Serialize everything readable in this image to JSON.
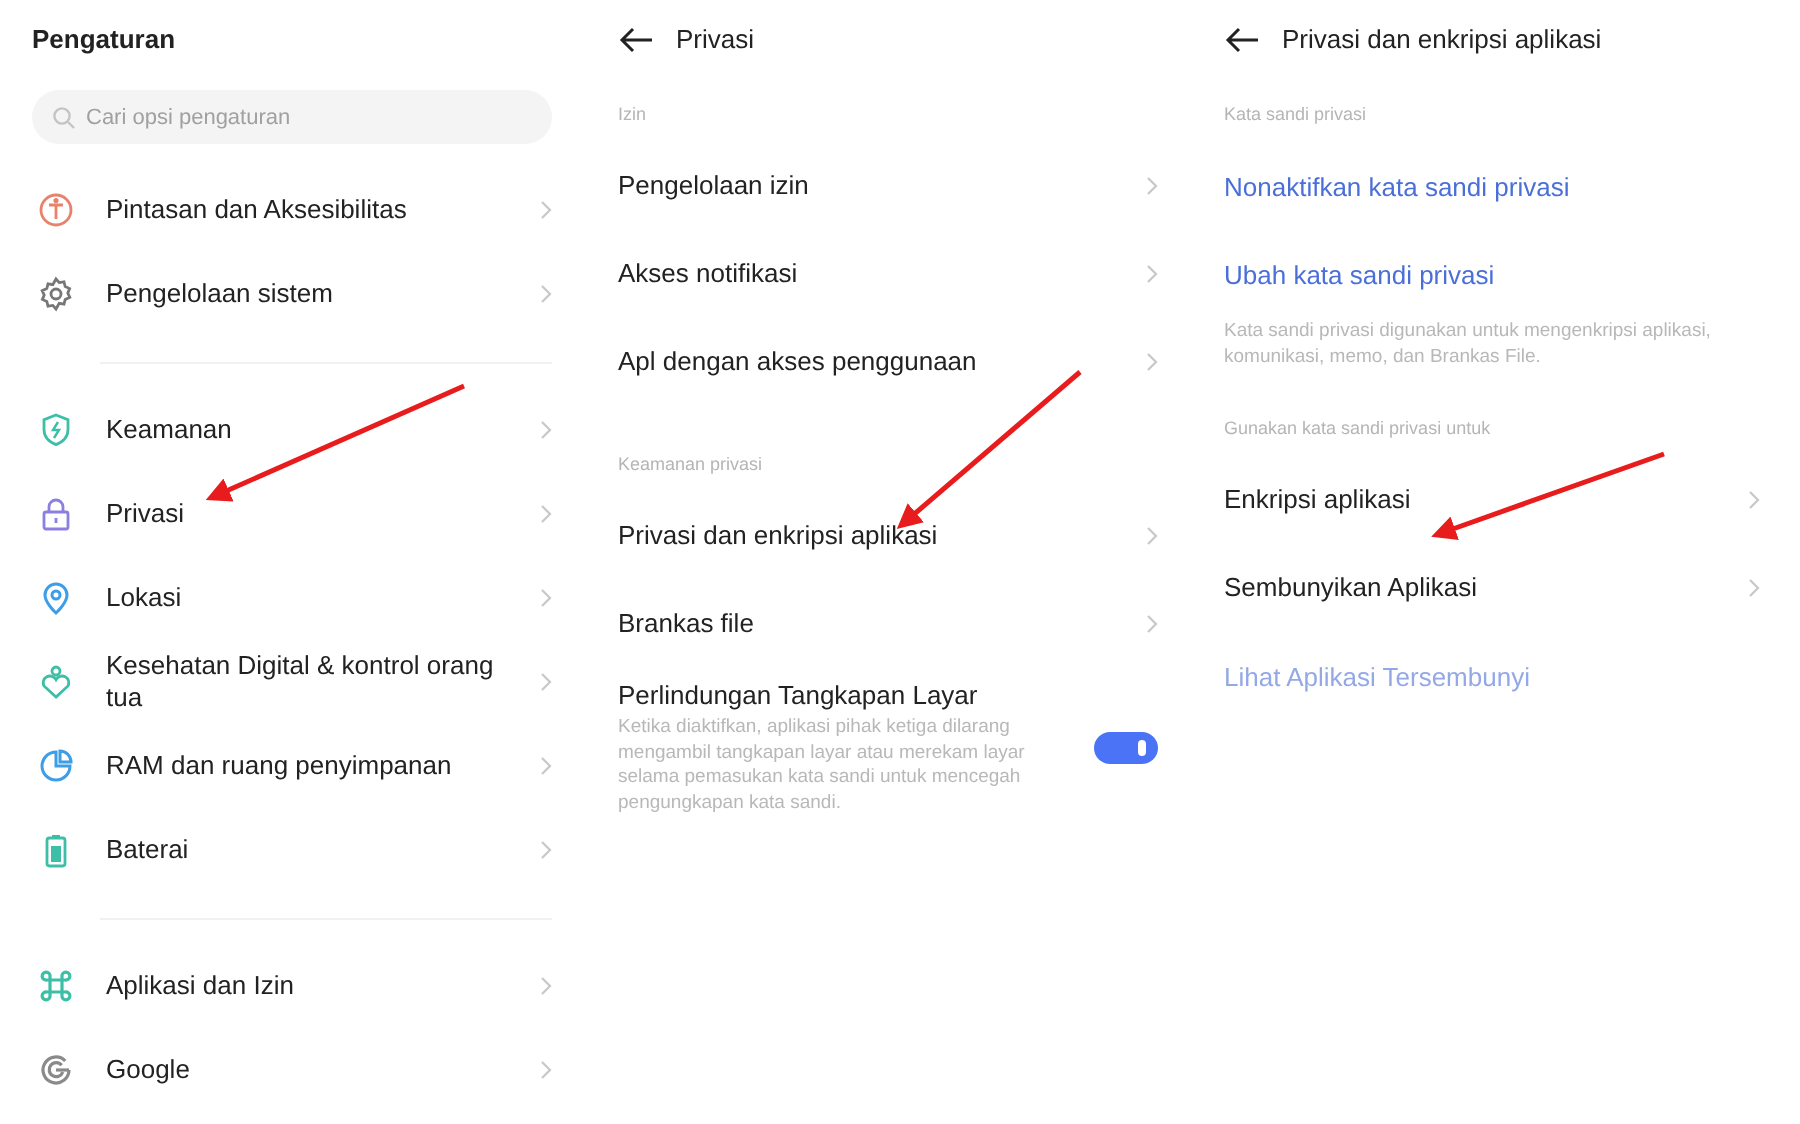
{
  "screens": [
    {
      "kind": "settings",
      "title": "Pengaturan",
      "search": {
        "placeholder": "Cari opsi pengaturan"
      },
      "groups": [
        {
          "items": [
            {
              "label": "Pintasan dan Aksesibilitas",
              "kind": "accessibility",
              "color": "#e8826c"
            },
            {
              "label": "Pengelolaan sistem",
              "kind": "gear",
              "color": "#777777"
            }
          ]
        },
        {
          "items": [
            {
              "label": "Keamanan",
              "kind": "shield",
              "color": "#3cbfa6"
            },
            {
              "label": "Privasi",
              "kind": "lock",
              "color": "#8b7fe0"
            },
            {
              "label": "Lokasi",
              "kind": "pin",
              "color": "#3d9de6"
            },
            {
              "label": "Kesehatan Digital & kontrol orang tua",
              "kind": "wellbeing",
              "color": "#3cbfa6"
            },
            {
              "label": "RAM dan ruang penyimpanan",
              "kind": "pie",
              "color": "#3d9de6"
            },
            {
              "label": "Baterai",
              "kind": "battery",
              "color": "#3cbfa6"
            }
          ]
        },
        {
          "items": [
            {
              "label": "Aplikasi dan Izin",
              "kind": "apps",
              "color": "#3cbfa6"
            },
            {
              "label": "Google",
              "kind": "google",
              "color": "#8a8a8a"
            }
          ]
        }
      ]
    },
    {
      "kind": "detail",
      "title": "Privasi",
      "sections": [
        {
          "label": "Izin",
          "items": [
            {
              "kind": "link",
              "label": "Pengelolaan izin"
            },
            {
              "kind": "link",
              "label": "Akses notifikasi"
            },
            {
              "kind": "link",
              "label": "Apl dengan akses penggunaan"
            }
          ]
        },
        {
          "label": "Keamanan privasi",
          "items": [
            {
              "kind": "link",
              "label": "Privasi dan enkripsi aplikasi"
            },
            {
              "kind": "link",
              "label": "Brankas file"
            },
            {
              "kind": "switch",
              "label": "Perlindungan Tangkapan Layar",
              "description": "Ketika diaktifkan, aplikasi pihak ketiga dilarang mengambil tangkapan layar atau merekam layar selama pemasukan kata sandi untuk mencegah pengungkapan kata sandi.",
              "on": true
            }
          ]
        }
      ]
    },
    {
      "kind": "detail",
      "title": "Privasi dan enkripsi aplikasi",
      "sections": [
        {
          "label": "Kata sandi privasi",
          "items": [
            {
              "kind": "action",
              "label": "Nonaktifkan kata sandi privasi",
              "disabled": false
            },
            {
              "kind": "action",
              "label": "Ubah kata sandi privasi",
              "disabled": false
            }
          ],
          "note": "Kata sandi privasi digunakan untuk mengenkripsi aplikasi, komunikasi, memo, dan Brankas File."
        },
        {
          "label": "Gunakan kata sandi privasi untuk",
          "items": [
            {
              "kind": "link",
              "label": "Enkripsi aplikasi"
            },
            {
              "kind": "link",
              "label": "Sembunyikan Aplikasi"
            },
            {
              "kind": "action",
              "label": "Lihat Aplikasi Tersembunyi",
              "disabled": true
            }
          ]
        }
      ]
    }
  ]
}
